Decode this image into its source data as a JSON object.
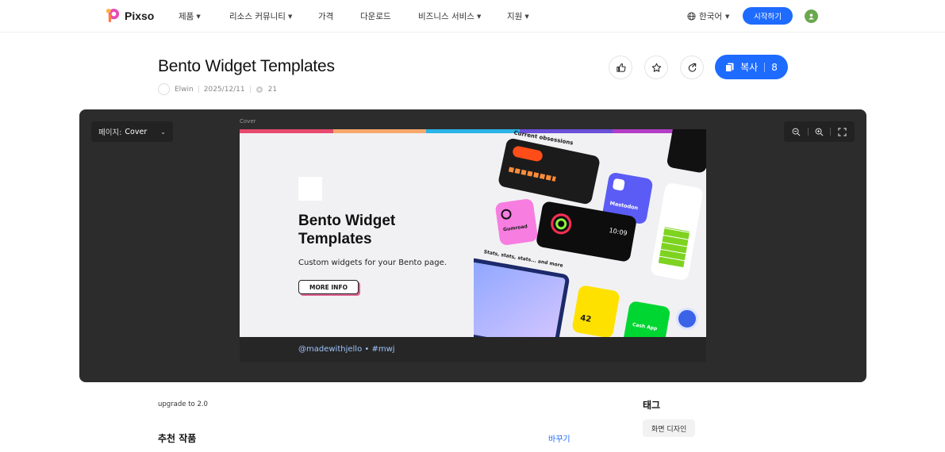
{
  "nav": {
    "brand": "Pixso",
    "items": [
      {
        "label": "제품",
        "dropdown": true
      },
      {
        "label": "리소스 커뮤니티",
        "dropdown": true
      },
      {
        "label": "가격",
        "dropdown": false
      },
      {
        "label": "다운로드",
        "dropdown": false
      },
      {
        "label": "비즈니스 서비스",
        "dropdown": true
      },
      {
        "label": "지원",
        "dropdown": true
      }
    ],
    "language": "한국어",
    "start_button": "시작하기"
  },
  "template": {
    "title": "Bento Widget Templates",
    "author": "Elwin",
    "date": "2025/12/11",
    "views": "21",
    "copy_label": "복사",
    "copy_count": "8"
  },
  "viewer": {
    "page_label": "페이지:",
    "page_value": "Cover",
    "frame_label": "Cover",
    "cover": {
      "title": "Bento Widget Templates",
      "subtitle": "Custom widgets for your Bento page.",
      "button": "MORE INFO",
      "footer": "@madewithjello • #mwj",
      "widgets": {
        "obsessions": "Current obsessions",
        "mastodon": "Mastodon",
        "gumroad": "Gumroad",
        "stats": "Stats, stats, stats... and more",
        "time": "10:09",
        "num1": "42",
        "cashapp": "Cash App"
      }
    },
    "stripe_colors": [
      "#e84a6f",
      "#f6a96b",
      "#2ab3e6",
      "#6a4fd8",
      "#b43cc8"
    ]
  },
  "description": "upgrade to 2.0",
  "recommended": {
    "title": "추천 작품",
    "change": "바꾸기"
  },
  "tags": {
    "title": "태그",
    "items": [
      "화면 디자인"
    ]
  },
  "colors": {
    "accent": "#1e6bff",
    "viewer_bg": "#2c2c2c"
  }
}
